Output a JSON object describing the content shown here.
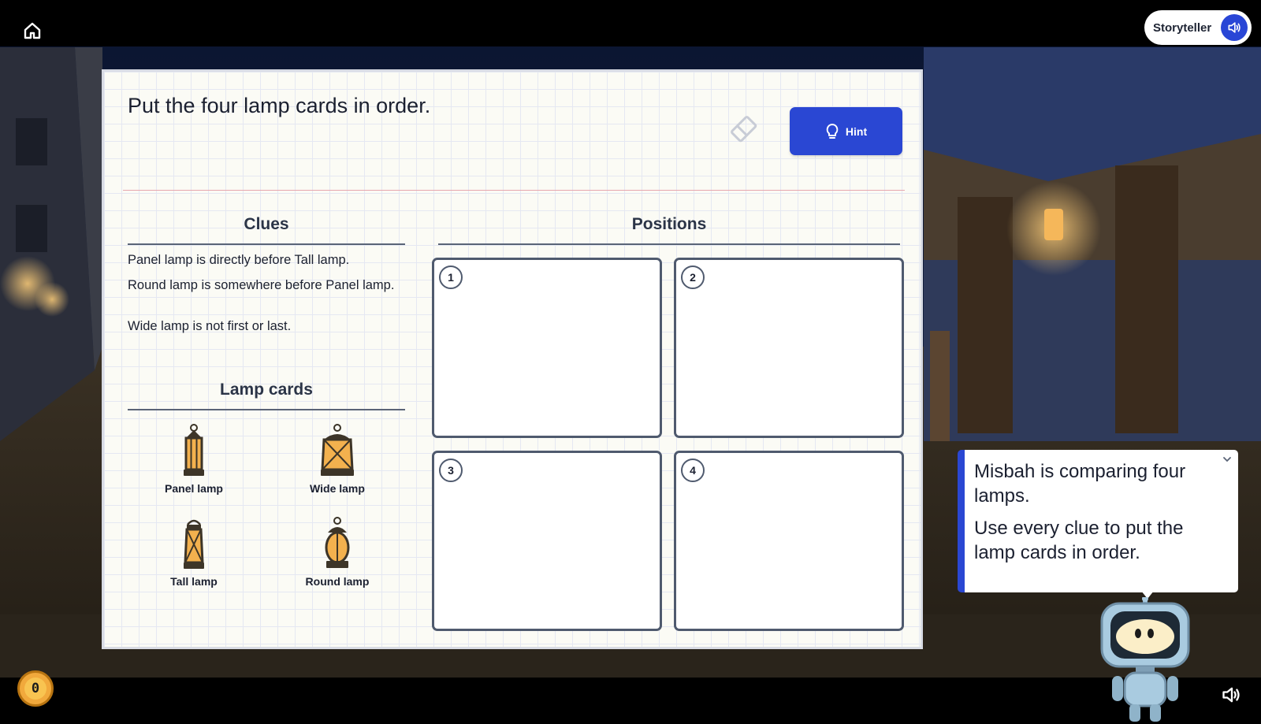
{
  "header": {
    "storyteller_label": "Storyteller"
  },
  "footer": {
    "coins": "0"
  },
  "puzzle": {
    "title": "Put the four lamp cards in order.",
    "hint_label": "Hint",
    "clues_title": "Clues",
    "clues": [
      "Panel lamp is directly before Tall lamp.",
      "Round lamp is somewhere before Panel lamp.",
      "Wide lamp is not first or last."
    ],
    "cards_title": "Lamp cards",
    "cards": [
      {
        "name": "Panel lamp"
      },
      {
        "name": "Wide lamp"
      },
      {
        "name": "Tall lamp"
      },
      {
        "name": "Round lamp"
      }
    ],
    "positions_title": "Positions",
    "positions": [
      "1",
      "2",
      "3",
      "4"
    ]
  },
  "narrator": {
    "lines": [
      "Misbah is comparing four lamps.",
      "Use every clue to put the lamp cards in order."
    ]
  },
  "colors": {
    "accent": "#2a47d3",
    "coin": "#f1a93c"
  }
}
